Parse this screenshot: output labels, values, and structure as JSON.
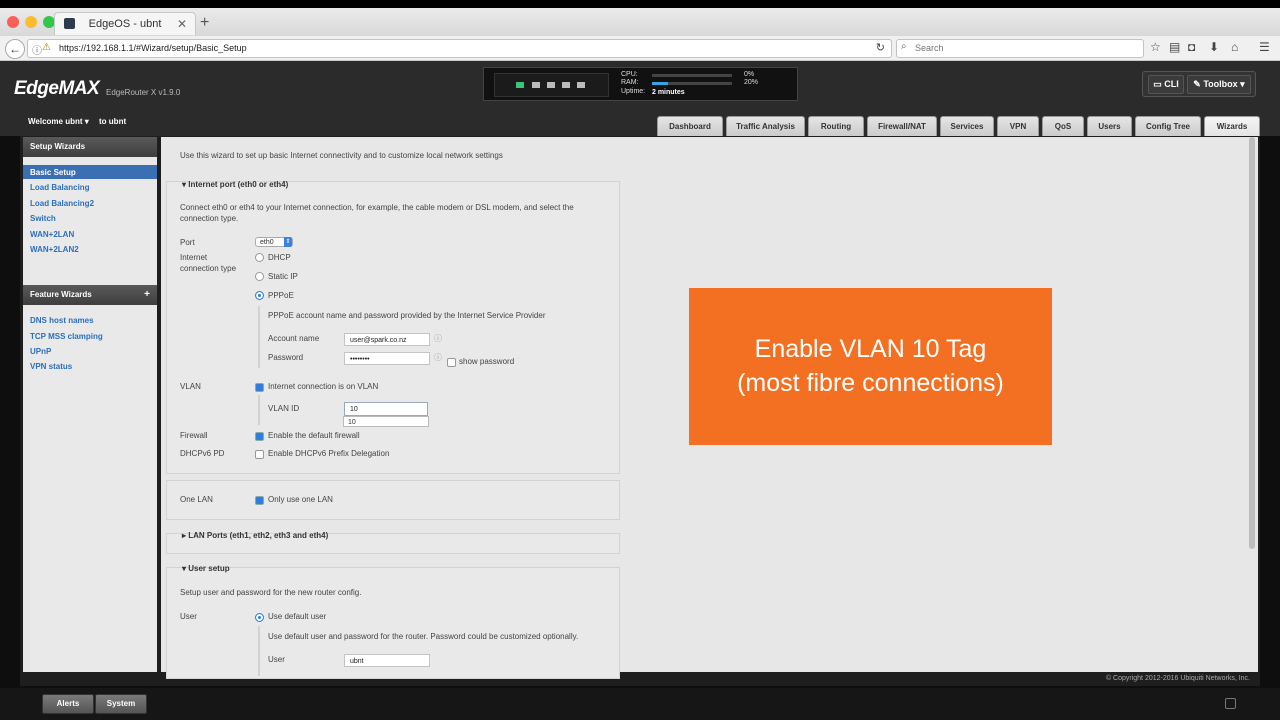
{
  "browser": {
    "tab_title": "EdgeOS - ubnt",
    "new_tab": "+",
    "url": "https://192.168.1.1/#Wizard/setup/Basic_Setup",
    "search_placeholder": "Search"
  },
  "header": {
    "logo": "EdgeMAX",
    "model": "EdgeRouter X v1.9.0",
    "stats": {
      "cpu_label": "CPU:",
      "cpu_value": "0%",
      "cpu_fraction": 0.0,
      "ram_label": "RAM:",
      "ram_value": "20%",
      "ram_fraction": 0.2,
      "uptime_label": "Uptime:",
      "uptime_value": "2 minutes"
    },
    "cli_label": "CLI",
    "toolbox_label": "Toolbox"
  },
  "subheader": {
    "welcome": "Welcome ubnt",
    "to_user": "to ubnt",
    "tabs": [
      "Dashboard",
      "Traffic Analysis",
      "Routing",
      "Firewall/NAT",
      "Services",
      "VPN",
      "QoS",
      "Users",
      "Config Tree",
      "Wizards"
    ],
    "active_tab": "Wizards"
  },
  "sidebar": {
    "setup_header": "Setup Wizards",
    "setup_items": [
      "Basic Setup",
      "Load Balancing",
      "Load Balancing2",
      "Switch",
      "WAN+2LAN",
      "WAN+2LAN2"
    ],
    "feature_header": "Feature Wizards",
    "feature_add": "+",
    "feature_items": [
      "DNS host names",
      "TCP MSS clamping",
      "UPnP",
      "VPN status"
    ]
  },
  "wizard": {
    "intro": "Use this wizard to set up basic Internet connectivity and to customize local network settings",
    "internet_port": {
      "title": "Internet port (eth0 or eth4)",
      "desc1": "Connect eth0 or eth4 to your Internet connection, for example, the cable modem or DSL modem, and select the",
      "desc2": "connection type.",
      "port_label": "Port",
      "port_value": "eth0",
      "conn_label1": "Internet",
      "conn_label2": "connection type",
      "opt_dhcp": "DHCP",
      "opt_static": "Static IP",
      "opt_pppoe": "PPPoE",
      "pppoe_desc": "PPPoE account name and password provided by the Internet Service Provider",
      "account_label": "Account name",
      "account_value": "user@spark.co.nz",
      "password_label": "Password",
      "password_value": "••••••••",
      "show_password": "show password",
      "vlan_label": "VLAN",
      "vlan_check": "Internet connection is on VLAN",
      "vlan_id_label": "VLAN ID",
      "vlan_id_value": "10",
      "vlan_suggestion": "10",
      "firewall_label": "Firewall",
      "firewall_check": "Enable the default firewall",
      "dhcpv6_label": "DHCPv6 PD",
      "dhcpv6_check": "Enable DHCPv6 Prefix Delegation"
    },
    "one_lan": {
      "label": "One LAN",
      "check": "Only use one LAN"
    },
    "lan_ports_title": "LAN Ports (eth1, eth2, eth3 and eth4)",
    "user_setup": {
      "title": "User setup",
      "desc": "Setup user and password for the new router config.",
      "user_label": "User",
      "use_default": "Use default user",
      "default_desc": "Use default user and password for the router. Password could be customized optionally.",
      "user_field_label": "User",
      "user_field_value": "ubnt"
    }
  },
  "overlay": {
    "line1": "Enable VLAN 10 Tag",
    "line2": "(most fibre connections)"
  },
  "footer": {
    "copyright": "© Copyright 2012-2016 Ubiquiti Networks, Inc."
  },
  "bottombar": {
    "alerts": "Alerts",
    "system": "System"
  },
  "colors": {
    "overlay": "#f37022",
    "accent": "#2e7ee0",
    "header_bg": "#2b2b2b"
  }
}
